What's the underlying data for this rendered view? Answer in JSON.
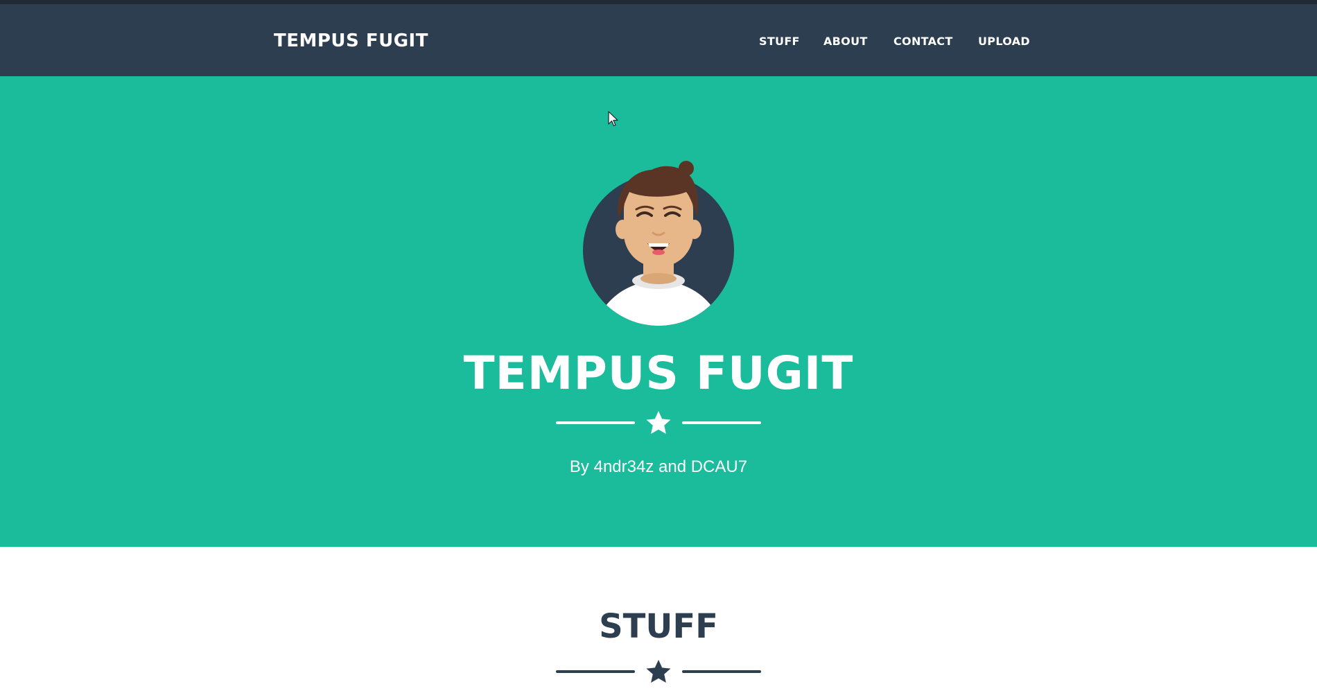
{
  "navbar": {
    "brand": "TEMPUS FUGIT",
    "items": [
      {
        "label": "STUFF"
      },
      {
        "label": "ABOUT"
      },
      {
        "label": "CONTACT"
      },
      {
        "label": "UPLOAD"
      }
    ]
  },
  "hero": {
    "avatar_icon": "smiling-person-avatar-icon",
    "title": "TEMPUS FUGIT",
    "divider_icon": "star-icon",
    "subtitle": "By 4ndr34z and DCAU7"
  },
  "stuff_section": {
    "title": "STUFF",
    "divider_icon": "star-icon"
  },
  "colors": {
    "navbar_bg": "#2c3e50",
    "hero_bg": "#1abc9c",
    "text_light": "#ffffff",
    "text_dark": "#2c3e50"
  }
}
